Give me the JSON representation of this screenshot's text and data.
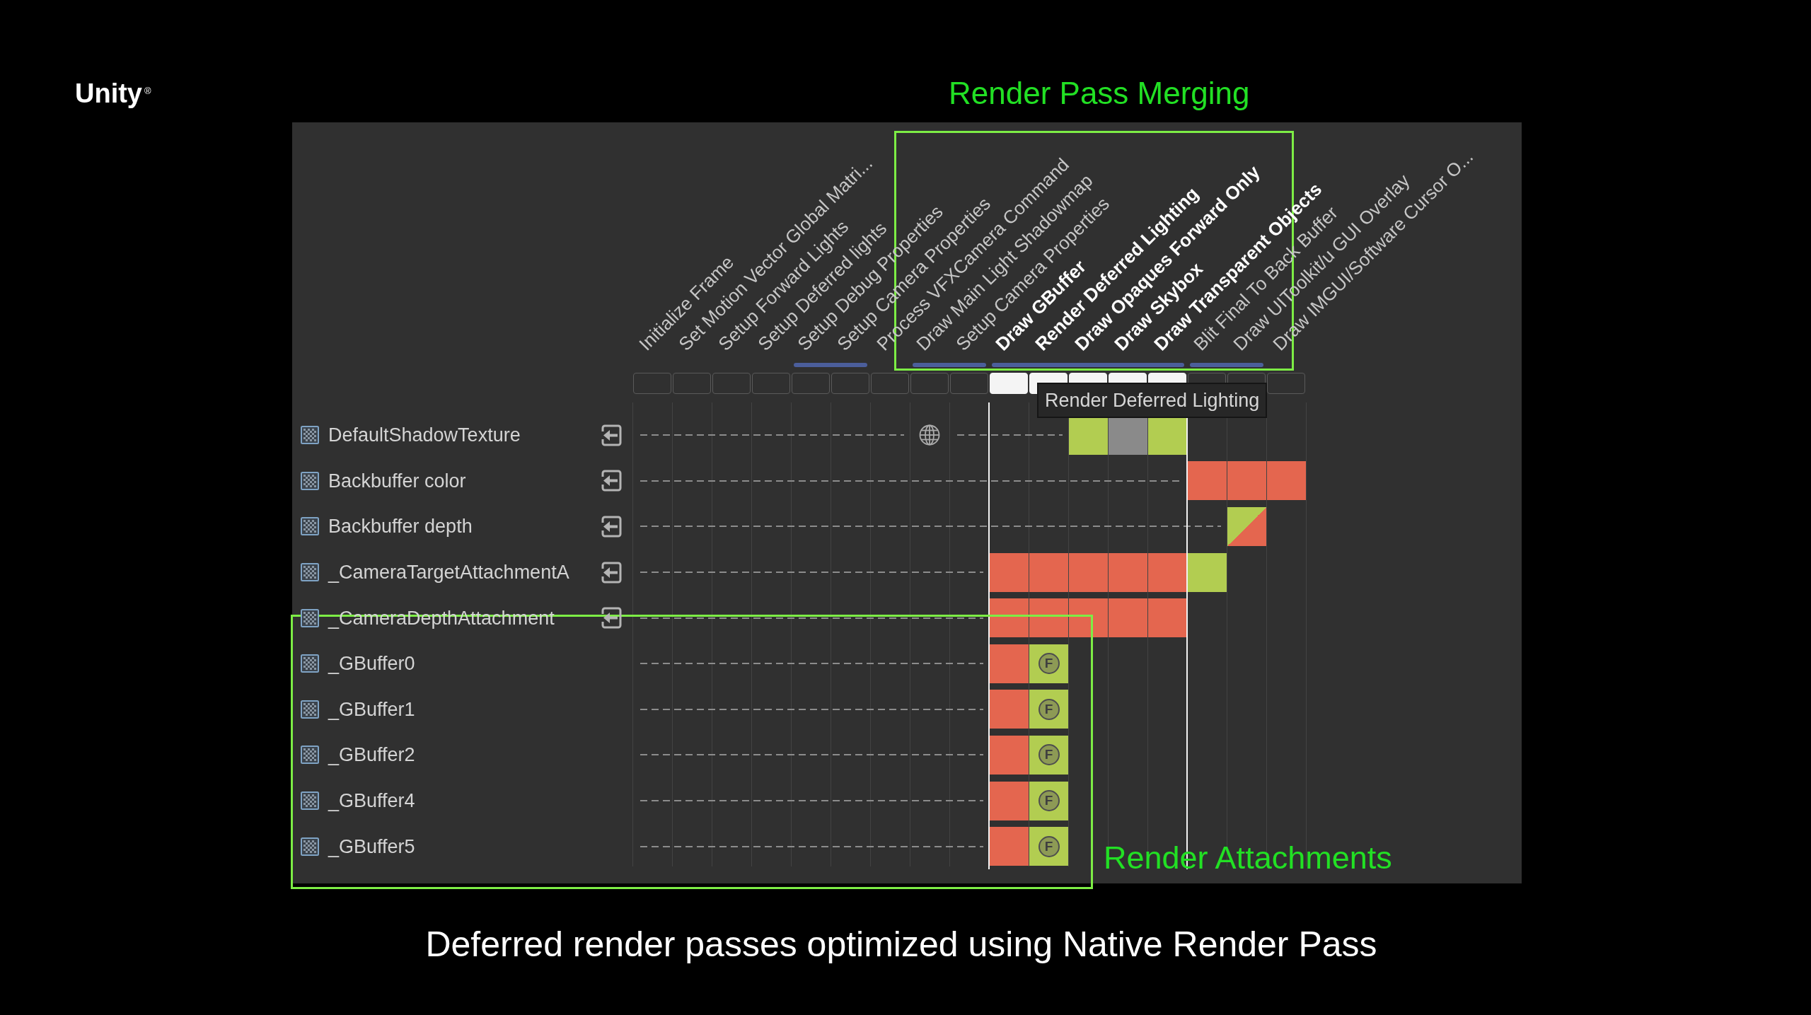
{
  "logo": {
    "name": "Unity",
    "mark": "®"
  },
  "annotations": [
    {
      "text": "Render Pass Merging"
    },
    {
      "text": "Render Attachments"
    }
  ],
  "render_graph": {
    "passes": [
      {
        "label": "Initialize Frame",
        "selected": false,
        "merged_with_next": false
      },
      {
        "label": "Set Motion Vector Global Matri...",
        "selected": false,
        "merged_with_next": false
      },
      {
        "label": "Setup Forward Lights",
        "selected": false,
        "merged_with_next": false
      },
      {
        "label": "Setup Deferred lights",
        "selected": false,
        "merged_with_next": false
      },
      {
        "label": "Setup Debug Properties",
        "selected": false,
        "merged_with_next": true
      },
      {
        "label": "Setup Camera Properties",
        "selected": false,
        "merged_with_next": false
      },
      {
        "label": "Process VFXCamera Command",
        "selected": false,
        "merged_with_next": false
      },
      {
        "label": "Draw Main Light Shadowmap",
        "selected": false,
        "merged_with_next": true
      },
      {
        "label": "Setup Camera Properties",
        "selected": false,
        "merged_with_next": false
      },
      {
        "label": "Draw GBuffer",
        "selected": true,
        "merged_with_next": true
      },
      {
        "label": "Render Deferred Lighting",
        "selected": true,
        "merged_with_next": true
      },
      {
        "label": "Draw Opaques Forward Only",
        "selected": true,
        "merged_with_next": true
      },
      {
        "label": "Draw Skybox",
        "selected": true,
        "merged_with_next": true
      },
      {
        "label": "Draw Transparent Objects",
        "selected": true,
        "merged_with_next": false
      },
      {
        "label": "Blit Final To Back Buffer",
        "selected": false,
        "merged_with_next": true
      },
      {
        "label": "Draw UIToolkit/u GUI Overlay",
        "selected": false,
        "merged_with_next": false
      },
      {
        "label": "Draw IMGUI/Software Cursor O...",
        "selected": false,
        "merged_with_next": false
      }
    ],
    "tooltip": "Render Deferred Lighting",
    "resources": [
      {
        "name": "DefaultShadowTexture",
        "imported": true,
        "cells": [
          {
            "kind": "none"
          },
          {
            "kind": "none"
          },
          {
            "kind": "none"
          },
          {
            "kind": "none"
          },
          {
            "kind": "none"
          },
          {
            "kind": "none"
          },
          {
            "kind": "none"
          },
          {
            "kind": "global"
          },
          {
            "kind": "none"
          },
          {
            "kind": "none"
          },
          {
            "kind": "none"
          },
          {
            "kind": "read"
          },
          {
            "kind": "idle"
          },
          {
            "kind": "read"
          },
          {
            "kind": "none"
          },
          {
            "kind": "none"
          },
          {
            "kind": "none"
          }
        ]
      },
      {
        "name": "Backbuffer color",
        "imported": true,
        "cells": [
          {
            "kind": "none"
          },
          {
            "kind": "none"
          },
          {
            "kind": "none"
          },
          {
            "kind": "none"
          },
          {
            "kind": "none"
          },
          {
            "kind": "none"
          },
          {
            "kind": "none"
          },
          {
            "kind": "none"
          },
          {
            "kind": "none"
          },
          {
            "kind": "none"
          },
          {
            "kind": "none"
          },
          {
            "kind": "none"
          },
          {
            "kind": "none"
          },
          {
            "kind": "none"
          },
          {
            "kind": "write"
          },
          {
            "kind": "write"
          },
          {
            "kind": "write"
          }
        ]
      },
      {
        "name": "Backbuffer depth",
        "imported": true,
        "cells": [
          {
            "kind": "none"
          },
          {
            "kind": "none"
          },
          {
            "kind": "none"
          },
          {
            "kind": "none"
          },
          {
            "kind": "none"
          },
          {
            "kind": "none"
          },
          {
            "kind": "none"
          },
          {
            "kind": "none"
          },
          {
            "kind": "none"
          },
          {
            "kind": "none"
          },
          {
            "kind": "none"
          },
          {
            "kind": "none"
          },
          {
            "kind": "none"
          },
          {
            "kind": "none"
          },
          {
            "kind": "none"
          },
          {
            "kind": "read_write"
          },
          {
            "kind": "none"
          }
        ]
      },
      {
        "name": "_CameraTargetAttachmentA",
        "imported": true,
        "cells": [
          {
            "kind": "none"
          },
          {
            "kind": "none"
          },
          {
            "kind": "none"
          },
          {
            "kind": "none"
          },
          {
            "kind": "none"
          },
          {
            "kind": "none"
          },
          {
            "kind": "none"
          },
          {
            "kind": "none"
          },
          {
            "kind": "none"
          },
          {
            "kind": "write"
          },
          {
            "kind": "write"
          },
          {
            "kind": "write"
          },
          {
            "kind": "write"
          },
          {
            "kind": "write"
          },
          {
            "kind": "read"
          },
          {
            "kind": "none"
          },
          {
            "kind": "none"
          }
        ]
      },
      {
        "name": "_CameraDepthAttachment",
        "imported": true,
        "cells": [
          {
            "kind": "none"
          },
          {
            "kind": "none"
          },
          {
            "kind": "none"
          },
          {
            "kind": "none"
          },
          {
            "kind": "none"
          },
          {
            "kind": "none"
          },
          {
            "kind": "none"
          },
          {
            "kind": "none"
          },
          {
            "kind": "none"
          },
          {
            "kind": "write"
          },
          {
            "kind": "write"
          },
          {
            "kind": "write"
          },
          {
            "kind": "write"
          },
          {
            "kind": "write"
          },
          {
            "kind": "none"
          },
          {
            "kind": "none"
          },
          {
            "kind": "none"
          }
        ]
      },
      {
        "name": "_GBuffer0",
        "imported": false,
        "cells": [
          {
            "kind": "none"
          },
          {
            "kind": "none"
          },
          {
            "kind": "none"
          },
          {
            "kind": "none"
          },
          {
            "kind": "none"
          },
          {
            "kind": "none"
          },
          {
            "kind": "none"
          },
          {
            "kind": "none"
          },
          {
            "kind": "none"
          },
          {
            "kind": "write"
          },
          {
            "kind": "read",
            "badge": "F"
          },
          {
            "kind": "none"
          },
          {
            "kind": "none"
          },
          {
            "kind": "none"
          },
          {
            "kind": "none"
          },
          {
            "kind": "none"
          },
          {
            "kind": "none"
          }
        ]
      },
      {
        "name": "_GBuffer1",
        "imported": false,
        "cells": [
          {
            "kind": "none"
          },
          {
            "kind": "none"
          },
          {
            "kind": "none"
          },
          {
            "kind": "none"
          },
          {
            "kind": "none"
          },
          {
            "kind": "none"
          },
          {
            "kind": "none"
          },
          {
            "kind": "none"
          },
          {
            "kind": "none"
          },
          {
            "kind": "write"
          },
          {
            "kind": "read",
            "badge": "F"
          },
          {
            "kind": "none"
          },
          {
            "kind": "none"
          },
          {
            "kind": "none"
          },
          {
            "kind": "none"
          },
          {
            "kind": "none"
          },
          {
            "kind": "none"
          }
        ]
      },
      {
        "name": "_GBuffer2",
        "imported": false,
        "cells": [
          {
            "kind": "none"
          },
          {
            "kind": "none"
          },
          {
            "kind": "none"
          },
          {
            "kind": "none"
          },
          {
            "kind": "none"
          },
          {
            "kind": "none"
          },
          {
            "kind": "none"
          },
          {
            "kind": "none"
          },
          {
            "kind": "none"
          },
          {
            "kind": "write"
          },
          {
            "kind": "read",
            "badge": "F"
          },
          {
            "kind": "none"
          },
          {
            "kind": "none"
          },
          {
            "kind": "none"
          },
          {
            "kind": "none"
          },
          {
            "kind": "none"
          },
          {
            "kind": "none"
          }
        ]
      },
      {
        "name": "_GBuffer4",
        "imported": false,
        "cells": [
          {
            "kind": "none"
          },
          {
            "kind": "none"
          },
          {
            "kind": "none"
          },
          {
            "kind": "none"
          },
          {
            "kind": "none"
          },
          {
            "kind": "none"
          },
          {
            "kind": "none"
          },
          {
            "kind": "none"
          },
          {
            "kind": "none"
          },
          {
            "kind": "write"
          },
          {
            "kind": "read",
            "badge": "F"
          },
          {
            "kind": "none"
          },
          {
            "kind": "none"
          },
          {
            "kind": "none"
          },
          {
            "kind": "none"
          },
          {
            "kind": "none"
          },
          {
            "kind": "none"
          }
        ]
      },
      {
        "name": "_GBuffer5",
        "imported": false,
        "cells": [
          {
            "kind": "none"
          },
          {
            "kind": "none"
          },
          {
            "kind": "none"
          },
          {
            "kind": "none"
          },
          {
            "kind": "none"
          },
          {
            "kind": "none"
          },
          {
            "kind": "none"
          },
          {
            "kind": "none"
          },
          {
            "kind": "none"
          },
          {
            "kind": "write"
          },
          {
            "kind": "read",
            "badge": "F"
          },
          {
            "kind": "none"
          },
          {
            "kind": "none"
          },
          {
            "kind": "none"
          },
          {
            "kind": "none"
          },
          {
            "kind": "none"
          },
          {
            "kind": "none"
          }
        ]
      }
    ]
  },
  "caption": "Deferred render passes optimized using Native Render Pass"
}
